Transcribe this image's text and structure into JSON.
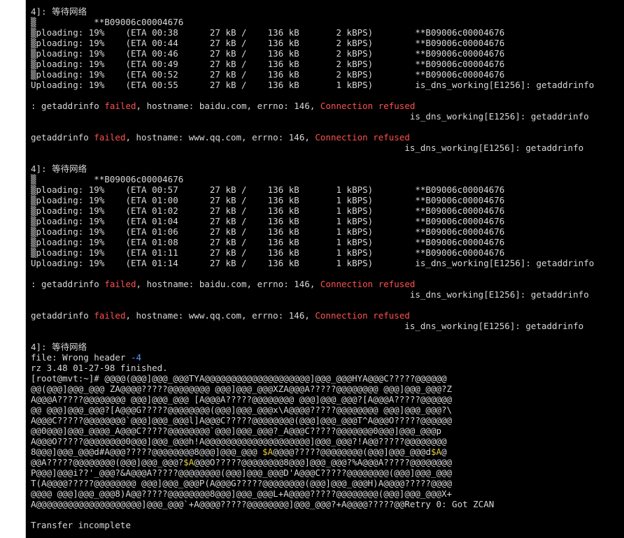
{
  "colors": {
    "background": "#000000",
    "text": "#d8d8d8",
    "error": "#ff5050",
    "info": "#5c9cff",
    "highlight": "#e8d23a"
  },
  "terminal": {
    "lines": [
      [
        {
          "t": "4]: 等待网络"
        }
      ],
      [
        {
          "t": "▒           **B09006c00004676"
        }
      ],
      [
        {
          "t": "▒ploading: 19%    (ETA 00:38      27 kB /    136 kB       2 kBPS)        **B09006c00004676"
        }
      ],
      [
        {
          "t": "▒ploading: 19%    (ETA 00:44      27 kB /    136 kB       2 kBPS)        **B09006c00004676"
        }
      ],
      [
        {
          "t": "▒ploading: 19%    (ETA 00:46      27 kB /    136 kB       2 kBPS)        **B09006c00004676"
        }
      ],
      [
        {
          "t": "▒ploading: 19%    (ETA 00:49      27 kB /    136 kB       2 kBPS)        **B09006c00004676"
        }
      ],
      [
        {
          "t": "▒ploading: 19%    (ETA 00:52      27 kB /    136 kB       2 kBPS)        **B09006c00004676"
        }
      ],
      [
        {
          "t": "Uploading: 19%    (ETA 00:55      27 kB /    136 kB       1 kBPS)        is_dns_working[E1256]: getaddrinfo"
        }
      ],
      [
        {
          "t": ""
        }
      ],
      [
        {
          "t": ": getaddrinfo "
        },
        {
          "t": "failed",
          "c": "red"
        },
        {
          "t": ", hostname: baidu.com, errno: 146, "
        },
        {
          "t": "Connection refused",
          "c": "red"
        }
      ],
      [
        {
          "t": "                                                                        is_dns_working[E1256]: getaddrinfo"
        }
      ],
      [
        {
          "t": ""
        }
      ],
      [
        {
          "t": "getaddrinfo "
        },
        {
          "t": "failed",
          "c": "red"
        },
        {
          "t": ", hostname: www.qq.com, errno: 146, "
        },
        {
          "t": "Connection refused",
          "c": "red"
        }
      ],
      [
        {
          "t": "                                                                       is_dns_working[E1256]: getaddrinfo"
        }
      ],
      [
        {
          "t": ""
        }
      ],
      [
        {
          "t": "4]: 等待网络"
        }
      ],
      [
        {
          "t": "▒           **B09006c00004676"
        }
      ],
      [
        {
          "t": "▒ploading: 19%    (ETA 00:57      27 kB /    136 kB       1 kBPS)        **B09006c00004676"
        }
      ],
      [
        {
          "t": "▒ploading: 19%    (ETA 01:00      27 kB /    136 kB       1 kBPS)        **B09006c00004676"
        }
      ],
      [
        {
          "t": "▒ploading: 19%    (ETA 01:02      27 kB /    136 kB       1 kBPS)        **B09006c00004676"
        }
      ],
      [
        {
          "t": "▒ploading: 19%    (ETA 01:04      27 kB /    136 kB       1 kBPS)        **B09006c00004676"
        }
      ],
      [
        {
          "t": "▒ploading: 19%    (ETA 01:06      27 kB /    136 kB       1 kBPS)        **B09006c00004676"
        }
      ],
      [
        {
          "t": "▒ploading: 19%    (ETA 01:08      27 kB /    136 kB       1 kBPS)        **B09006c00004676"
        }
      ],
      [
        {
          "t": "▒ploading: 19%    (ETA 01:11      27 kB /    136 kB       1 kBPS)        **B09006c00004676"
        }
      ],
      [
        {
          "t": "Uploading: 19%    (ETA 01:14      27 kB /    136 kB       1 kBPS)        is_dns_working[E1256]: getaddrinfo"
        }
      ],
      [
        {
          "t": ""
        }
      ],
      [
        {
          "t": ": getaddrinfo "
        },
        {
          "t": "failed",
          "c": "red"
        },
        {
          "t": ", hostname: baidu.com, errno: 146, "
        },
        {
          "t": "Connection refused",
          "c": "red"
        }
      ],
      [
        {
          "t": "                                                                        is_dns_working[E1256]: getaddrinfo"
        }
      ],
      [
        {
          "t": ""
        }
      ],
      [
        {
          "t": "getaddrinfo "
        },
        {
          "t": "failed",
          "c": "red"
        },
        {
          "t": ", hostname: www.qq.com, errno: 146, "
        },
        {
          "t": "Connection refused",
          "c": "red"
        }
      ],
      [
        {
          "t": "                                                                       is_dns_working[E1256]: getaddrinfo"
        }
      ],
      [
        {
          "t": ""
        }
      ],
      [
        {
          "t": "4]: 等待网络"
        }
      ],
      [
        {
          "t": "file: Wrong header "
        },
        {
          "t": "-4",
          "c": "blue"
        }
      ],
      [
        {
          "t": "rz 3.48 01-27-98 finished."
        }
      ],
      [
        {
          "t": "[root@mvt:~]# @@@@(@@@]@@@_@@@TYA@@@@@@@@@@@@@@@@@@@@]@@@_@@@HYA@@@C?????@@@@@@"
        }
      ],
      [
        {
          "t": "@@(@@@]@@@_@@@ ZA@@@@?????@@@@@@@@ @@@]@@@_@@@XZA@@@A?????@@@@@@@@ @@@]@@@_@@@?Z"
        }
      ],
      [
        {
          "t": "A@@@A?????@@@@@@@@ @@@]@@@_@@@ [A@@@A?????@@@@@@@@ @@@]@@@_@@@?[A@@@A?????@@@@@@"
        }
      ],
      [
        {
          "t": "@@ @@@]@@@_@@@?[A@@@G?????@@@@@@@@(@@@]@@@_@@@x\\A@@@@?????@@@@@@@@ @@@]@@@_@@@?\\"
        }
      ],
      [
        {
          "t": "A@@@C?????@@@@@@@@`@@@]@@@_@@@l]A@@@C?????@@@@@@@@(@@@]@@@_@@@T^A@@@O?????@@@@@@"
        }
      ],
      [
        {
          "t": "@@0@@@]@@@_@@@@_A@@@C?????@@@@@@@@`@@@]@@@_@@@?_A@@@C?????@@@@@@@0@@@]@@@_@@@p"
        }
      ],
      [
        {
          "t": "A@@@O?????@@@@@@@@0@@@]@@@_@@@h!A@@@@@@@@@@@@@@@@@@@@]@@@_@@@?!A@@?????@@@@@@@@"
        }
      ],
      [
        {
          "t": "8@@@]@@@_@@@d#A@@@?????@@@@@@@@8@@@]@@@_@@@ "
        },
        {
          "t": "$A",
          "c": "yellow"
        },
        {
          "t": "@@@@?????@@@@@@@@(@@@]@@@_@@@d"
        },
        {
          "t": "$A",
          "c": "yellow"
        },
        {
          "t": "@"
        }
      ],
      [
        {
          "t": "@@A?????@@@@@@@@(@@@]@@@_@@@?"
        },
        {
          "t": "$A",
          "c": "yellow"
        },
        {
          "t": "@@@O?????@@@@@@@@8@@@]@@@_@@@?%A@@@A?????@@@@@@@@"
        }
      ],
      [
        {
          "t": "P@@@]@@@i??'_@@@?&A@@@A?????@@@@@@@@(@@@]@@@_@@@D'A@@@C?????@@@@@@@@(@@@]@@@_@@@"
        }
      ],
      [
        {
          "t": "T(A@@@@?????@@@@@@@@ @@@]@@@_@@@P(A@@@G?????@@@@@@@@(@@@]@@@_@@@H)A@@@@?????@@@@"
        }
      ],
      [
        {
          "t": "@@@@ @@@]@@@_@@@8)A@@?????@@@@@@@@8@@@]@@@_@@@L+A@@@@?????@@@@@@@@(@@@]@@@_@@@X+"
        }
      ],
      [
        {
          "t": "A@@@@@@@@@@@@@@@@@@@@]@@@_@@@`+A@@@@?????@@@@@@@@]@@@_@@@?+A@@@@?????@@Retry 0: Got ZCAN"
        }
      ],
      [
        {
          "t": ""
        }
      ],
      [
        {
          "t": "Transfer incomplete"
        }
      ]
    ]
  }
}
